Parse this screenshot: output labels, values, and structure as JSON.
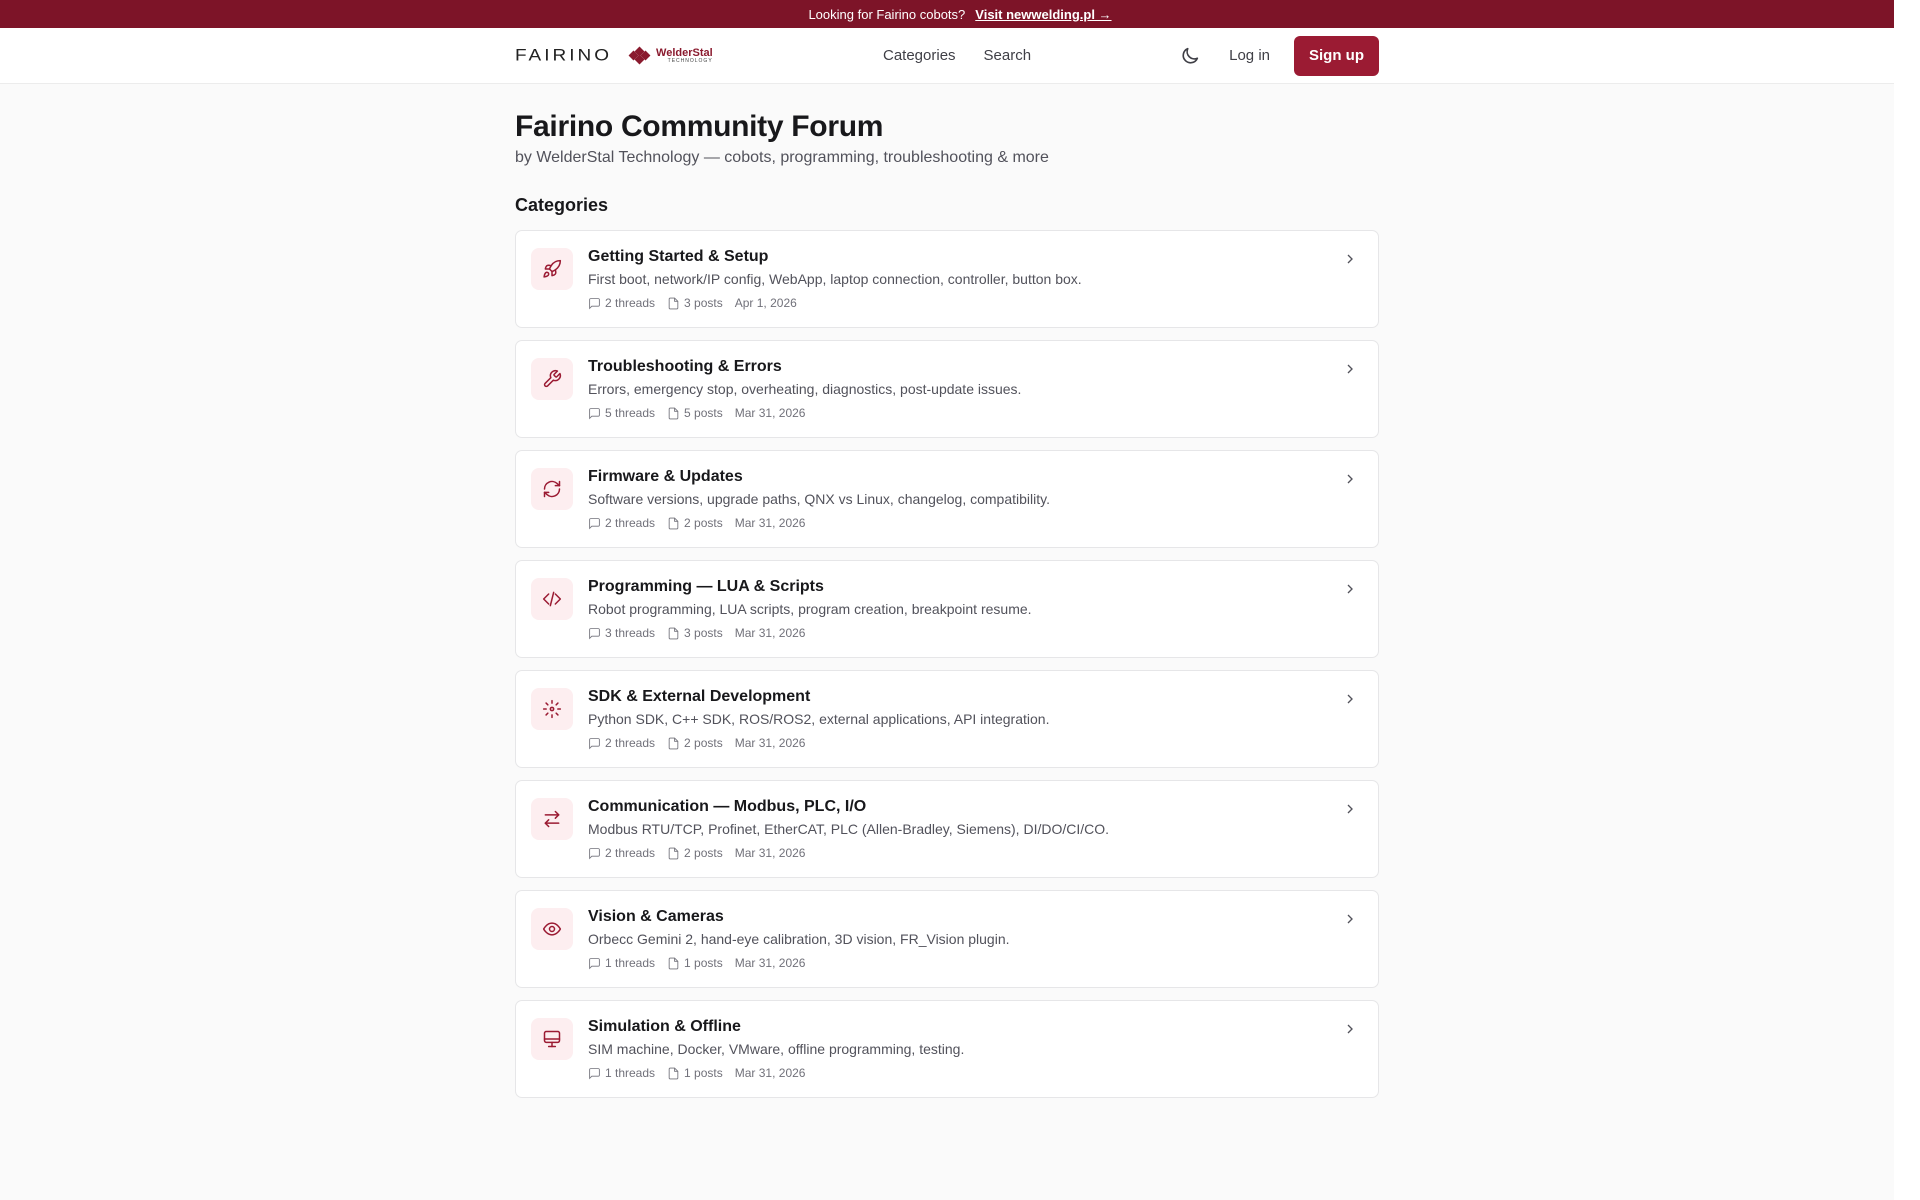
{
  "banner": {
    "text": "Looking for Fairino cobots?",
    "link": "Visit newwelding.pl →"
  },
  "nav": {
    "logo": "FAIRINO",
    "partner_logo_top": "WelderStal",
    "partner_logo_bottom": "TECHNOLOGY",
    "links": [
      "Categories",
      "Search"
    ],
    "login": "Log in",
    "signup": "Sign up"
  },
  "page": {
    "title": "Fairino Community Forum",
    "subtitle": "by WelderStal Technology — cobots, programming, troubleshooting & more",
    "categories_heading": "Categories"
  },
  "categories": [
    {
      "icon": "rocket-icon",
      "title": "Getting Started & Setup",
      "desc": "First boot, network/IP config, WebApp, laptop connection, controller, button box.",
      "threads": "2 threads",
      "posts": "3 posts",
      "date": "Apr 1, 2026"
    },
    {
      "icon": "wrench-icon",
      "title": "Troubleshooting & Errors",
      "desc": "Errors, emergency stop, overheating, diagnostics, post-update issues.",
      "threads": "5 threads",
      "posts": "5 posts",
      "date": "Mar 31, 2026"
    },
    {
      "icon": "refresh-icon",
      "title": "Firmware & Updates",
      "desc": "Software versions, upgrade paths, QNX vs Linux, changelog, compatibility.",
      "threads": "2 threads",
      "posts": "2 posts",
      "date": "Mar 31, 2026"
    },
    {
      "icon": "code-icon",
      "title": "Programming — LUA & Scripts",
      "desc": "Robot programming, LUA scripts, program creation, breakpoint resume.",
      "threads": "3 threads",
      "posts": "3 posts",
      "date": "Mar 31, 2026"
    },
    {
      "icon": "sdk-icon",
      "title": "SDK & External Development",
      "desc": "Python SDK, C++ SDK, ROS/ROS2, external applications, API integration.",
      "threads": "2 threads",
      "posts": "2 posts",
      "date": "Mar 31, 2026"
    },
    {
      "icon": "arrows-swap-icon",
      "title": "Communication — Modbus, PLC, I/O",
      "desc": "Modbus RTU/TCP, Profinet, EtherCAT, PLC (Allen-Bradley, Siemens), DI/DO/CI/CO.",
      "threads": "2 threads",
      "posts": "2 posts",
      "date": "Mar 31, 2026"
    },
    {
      "icon": "eye-icon",
      "title": "Vision & Cameras",
      "desc": "Orbecc Gemini 2, hand-eye calibration, 3D vision, FR_Vision plugin.",
      "threads": "1 threads",
      "posts": "1 posts",
      "date": "Mar 31, 2026"
    },
    {
      "icon": "monitor-icon",
      "title": "Simulation & Offline",
      "desc": "SIM machine, Docker, VMware, offline programming, testing.",
      "threads": "1 threads",
      "posts": "1 posts",
      "date": "Mar 31, 2026"
    }
  ],
  "colors": {
    "brand": "#9b1b33",
    "banner": "#7d1428",
    "icon_bg": "#fdeef0"
  }
}
